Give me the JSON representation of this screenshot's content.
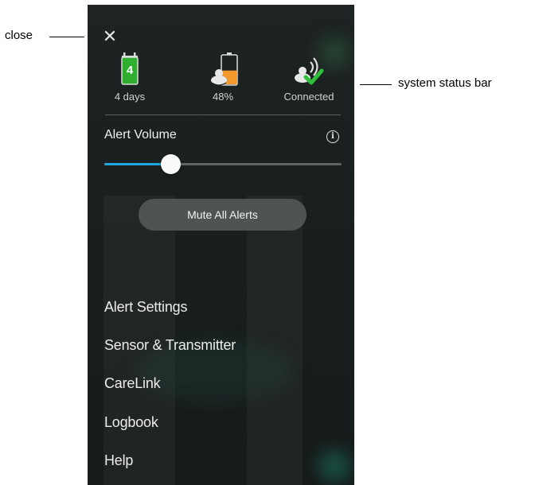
{
  "annotations": {
    "close_label": "close",
    "status_bar_label": "system status bar"
  },
  "panel": {
    "close_icon": "close-icon",
    "status": [
      {
        "icon": "calendar-icon",
        "value": "4",
        "label": "4 days",
        "color": "#2fae2f"
      },
      {
        "icon": "transmitter-battery-icon",
        "label": "48%",
        "level": 0.48,
        "color": "#f29a2e"
      },
      {
        "icon": "connection-icon",
        "label": "Connected",
        "color": "#2fbf3a"
      }
    ],
    "volume": {
      "title": "Alert Volume",
      "info_icon": "info-icon",
      "level": 0.28,
      "accent": "#1fa8e0"
    },
    "mute_label": "Mute All Alerts",
    "menu": [
      "Alert Settings",
      "Sensor & Transmitter",
      "CareLink",
      "Logbook",
      "Help"
    ]
  }
}
